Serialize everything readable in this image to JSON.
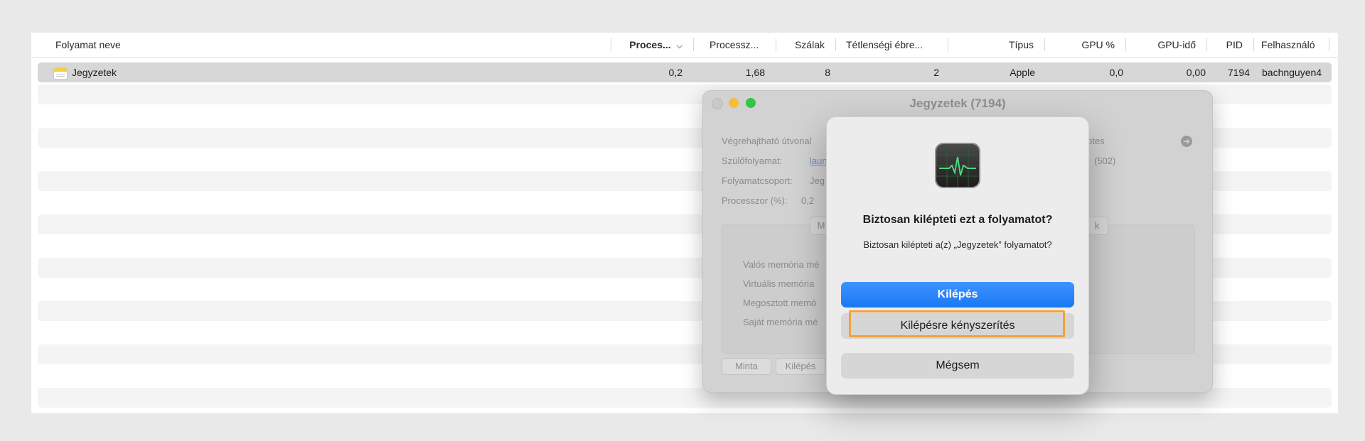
{
  "columns": [
    {
      "label": "Folyamat neve"
    },
    {
      "label": "Proces..."
    },
    {
      "label": "Processz..."
    },
    {
      "label": "Szálak"
    },
    {
      "label": "Tétlenségi ébre..."
    },
    {
      "label": "Típus"
    },
    {
      "label": "GPU %"
    },
    {
      "label": "GPU-idő"
    },
    {
      "label": "PID"
    },
    {
      "label": "Felhasználó"
    }
  ],
  "sort_indicator": "chevron-down",
  "process_row": {
    "name": "Jegyzetek",
    "icon": "notes-app-icon",
    "cpu_percent": "0,2",
    "cpu_time": "1,68",
    "threads": "8",
    "idle_wakeups": "2",
    "kind": "Apple",
    "gpu_percent": "0,0",
    "gpu_time": "0,00",
    "pid": "7194",
    "user": "bachnguyen4"
  },
  "info_window": {
    "title": "Jegyzetek (7194)",
    "labels": {
      "exec_path": "Végrehajtható útvonal",
      "parent": "Szülőfolyamat:",
      "group": "Folyamatcsoport:",
      "cpu": "Processzor (%):"
    },
    "values": {
      "parent": "laun",
      "group": "Jeg",
      "cpu": "0,2"
    },
    "right_values": {
      "exec_path_tail": "otes",
      "parent_tail": "(502)"
    },
    "tabs": [
      "M",
      "k"
    ],
    "memory_labels": [
      "Valós memória mé",
      "Virtuális memória",
      "Megosztott memó",
      "Saját memória mé"
    ],
    "buttons": {
      "sample": "Minta",
      "quit": "Kilépés"
    }
  },
  "alert": {
    "icon": "activity-monitor-icon",
    "title": "Biztosan kilépteti ezt a folyamatot?",
    "message": "Biztosan kilépteti a(z) „Jegyzetek” folyamatot?",
    "quit_label": "Kilépés",
    "force_quit_label": "Kilépésre kényszerítés",
    "cancel_label": "Mégsem"
  },
  "colors": {
    "accent": "#1a78f5",
    "highlight": "#f2a23b",
    "traffic_min": "#f5bd3a",
    "traffic_max": "#30c748"
  }
}
